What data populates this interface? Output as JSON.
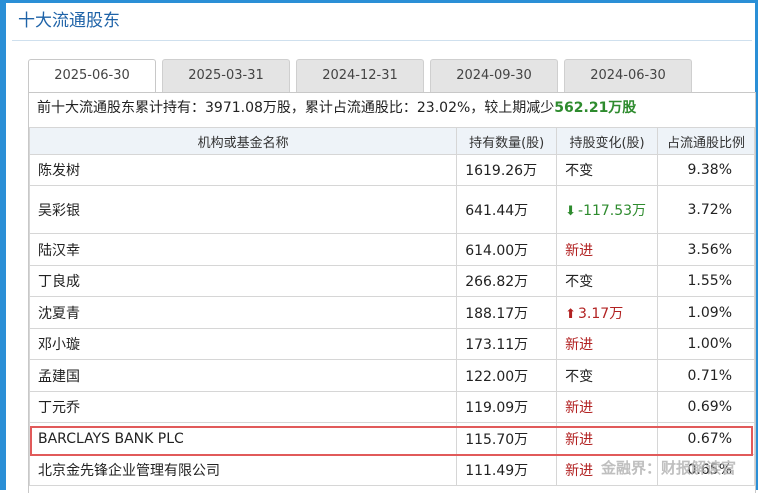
{
  "section_title": "十大流通股东",
  "tabs": [
    {
      "label": "2025-06-30",
      "active": true
    },
    {
      "label": "2025-03-31",
      "active": false
    },
    {
      "label": "2024-12-31",
      "active": false
    },
    {
      "label": "2024-09-30",
      "active": false
    },
    {
      "label": "2024-06-30",
      "active": false
    }
  ],
  "summary": {
    "prefix": "前十大流通股东累计持有：3971.08万股，累计占流通股比：23.02%，较上期减少",
    "change": "562.21万股"
  },
  "table": {
    "headers": [
      "机构或基金名称",
      "持有数量(股)",
      "持股变化(股)",
      "占流通股比例"
    ],
    "rows": [
      {
        "name": "陈发树",
        "shares": "1619.26万",
        "change": "不变",
        "change_type": "same",
        "ratio": "9.38%"
      },
      {
        "name": "吴彩银",
        "shares": "641.44万",
        "change": "-117.53万",
        "change_type": "down",
        "ratio": "3.72%"
      },
      {
        "name": "陆汉幸",
        "shares": "614.00万",
        "change": "新进",
        "change_type": "new",
        "ratio": "3.56%"
      },
      {
        "name": "丁良成",
        "shares": "266.82万",
        "change": "不变",
        "change_type": "same",
        "ratio": "1.55%"
      },
      {
        "name": "沈夏青",
        "shares": "188.17万",
        "change": "3.17万",
        "change_type": "up",
        "ratio": "1.09%"
      },
      {
        "name": "邓小璇",
        "shares": "173.11万",
        "change": "新进",
        "change_type": "new",
        "ratio": "1.00%"
      },
      {
        "name": "孟建国",
        "shares": "122.00万",
        "change": "不变",
        "change_type": "same",
        "ratio": "0.71%"
      },
      {
        "name": "丁元乔",
        "shares": "119.09万",
        "change": "新进",
        "change_type": "new",
        "ratio": "0.69%"
      },
      {
        "name": "BARCLAYS BANK PLC",
        "shares": "115.70万",
        "change": "新进",
        "change_type": "new",
        "ratio": "0.67%"
      },
      {
        "name": "北京金先锋企业管理有限公司",
        "shares": "111.49万",
        "change": "新进",
        "change_type": "new",
        "ratio": "0.65%"
      }
    ]
  },
  "watermark": "金融界：财报解读官",
  "colors": {
    "accent": "#2a8fd6",
    "up": "#b22222",
    "down": "#2e8b2e",
    "highlight": "#e15a5a"
  }
}
